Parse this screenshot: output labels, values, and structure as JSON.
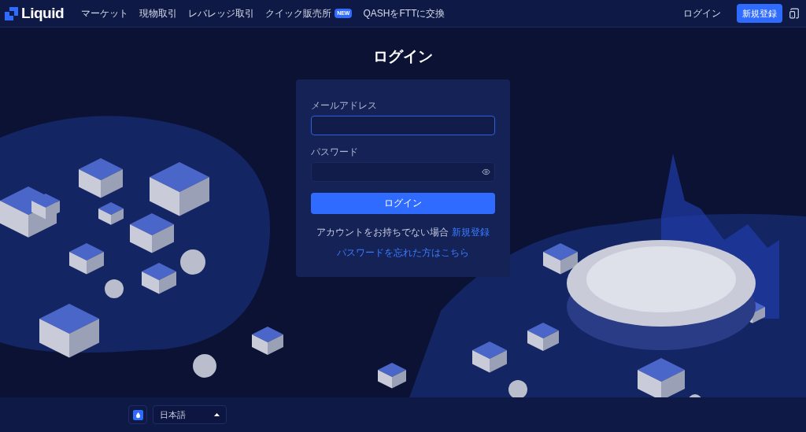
{
  "header": {
    "logo": "Liquid",
    "nav": [
      {
        "label": "マーケット"
      },
      {
        "label": "現物取引"
      },
      {
        "label": "レバレッジ取引"
      },
      {
        "label": "クイック販売所",
        "badge": "NEW"
      },
      {
        "label": "QASHをFTTに交換"
      }
    ],
    "login": "ログイン",
    "signup": "新規登録"
  },
  "title": "ログイン",
  "form": {
    "email_label": "メールアドレス",
    "email_focused": true,
    "password_label": "パスワード",
    "submit": "ログイン",
    "no_account": "アカウントをお持ちでない場合",
    "signup_link": "新規登録",
    "forgot": "パスワードを忘れた方はこちら"
  },
  "footer": {
    "language": "日本語"
  }
}
